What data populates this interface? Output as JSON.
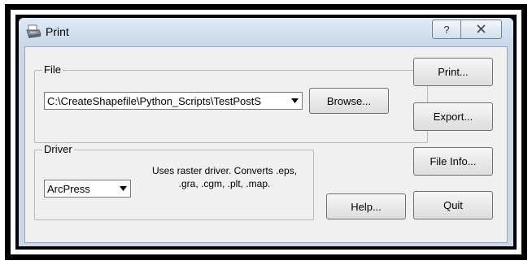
{
  "window": {
    "title": "Print",
    "help_button_glyph": "?",
    "close_button_glyph": "X"
  },
  "file_group": {
    "label": "File",
    "path_value": "C:\\CreateShapefile\\Python_Scripts\\TestPostS",
    "browse_label": "Browse..."
  },
  "driver_group": {
    "label": "Driver",
    "selected": "ArcPress",
    "description": "Uses raster driver.  Converts .eps, .gra, .cgm, .plt, .map."
  },
  "buttons": {
    "print": "Print...",
    "export": "Export...",
    "file_info": "File Info...",
    "help": "Help...",
    "quit": "Quit"
  },
  "icons": {
    "title": "printer-icon",
    "dropdown": "chevron-down-icon"
  }
}
